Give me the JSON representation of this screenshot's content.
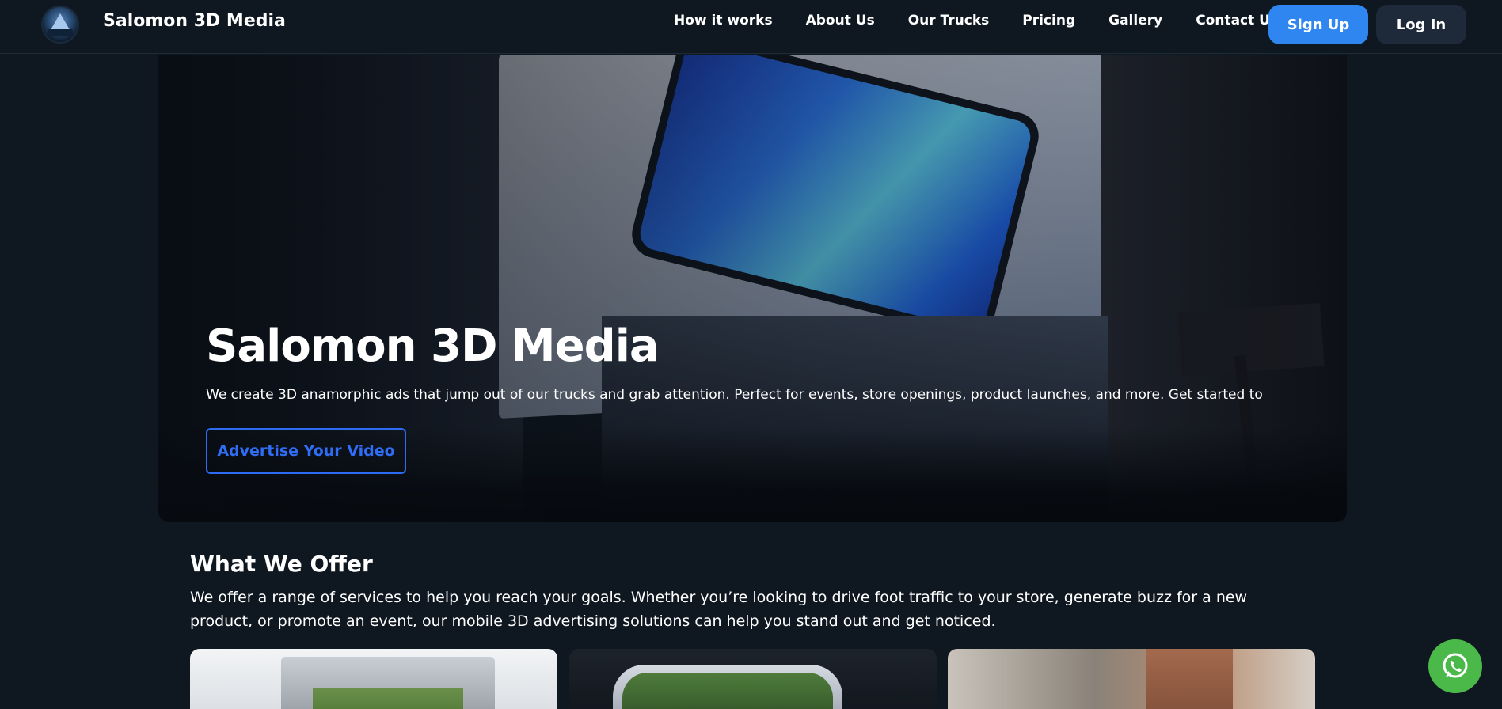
{
  "header": {
    "brand": "Salomon 3D Media",
    "logo_icon": "mountain-logo-icon",
    "nav": [
      {
        "label": "How it works"
      },
      {
        "label": "About Us"
      },
      {
        "label": "Our Trucks"
      },
      {
        "label": "Pricing"
      },
      {
        "label": "Gallery"
      },
      {
        "label": "Contact Us"
      }
    ],
    "signup_label": "Sign Up",
    "login_label": "Log In"
  },
  "hero": {
    "title": "Salomon 3D Media",
    "description": "We create 3D anamorphic ads that jump out of our trucks and grab attention. Perfect for events, store openings, product launches, and more. Get started to",
    "cta_label": "Advertise Your Video"
  },
  "offer": {
    "title": "What We Offer",
    "description": "We offer a range of services to help you reach your goals. Whether you’re looking to drive foot traffic to your store, generate buzz for a new product, or promote an event, our mobile 3D advertising solutions can help you stand out and get noticed."
  },
  "floating": {
    "chat_icon": "whatsapp-icon"
  },
  "colors": {
    "background": "#0f1720",
    "primary": "#2f86f0",
    "cta_outline": "#2c6bf2",
    "whatsapp": "#4bb94a"
  }
}
